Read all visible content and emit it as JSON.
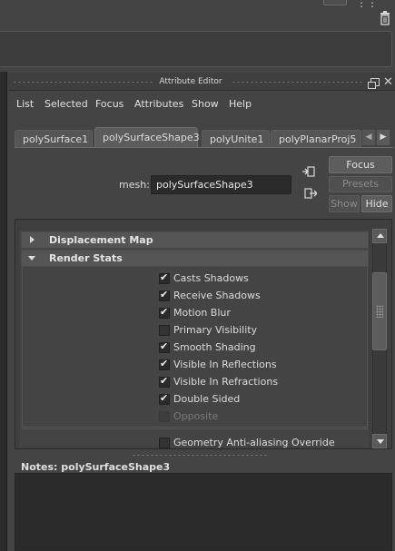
{
  "title": "Attribute Editor",
  "menu": [
    "List",
    "Selected",
    "Focus",
    "Attributes",
    "Show",
    "Help"
  ],
  "tabs": [
    {
      "label": "polySurface1",
      "active": false
    },
    {
      "label": "polySurfaceShape3",
      "active": true
    },
    {
      "label": "polyUnite1",
      "active": false
    },
    {
      "label": "polyPlanarProj5",
      "active": false
    }
  ],
  "mesh": {
    "label": "mesh:",
    "value": "polySurfaceShape3"
  },
  "buttons": {
    "focus": "Focus",
    "presets": "Presets",
    "show": "Show",
    "hide": "Hide"
  },
  "sections": {
    "displacement": {
      "label": "Displacement Map",
      "expanded": false
    },
    "render_stats": {
      "label": "Render Stats",
      "expanded": true
    }
  },
  "render_stats": [
    {
      "label": "Casts Shadows",
      "checked": true,
      "enabled": true
    },
    {
      "label": "Receive Shadows",
      "checked": true,
      "enabled": true
    },
    {
      "label": "Motion Blur",
      "checked": true,
      "enabled": true
    },
    {
      "label": "Primary Visibility",
      "checked": false,
      "enabled": true
    },
    {
      "label": "Smooth Shading",
      "checked": true,
      "enabled": true
    },
    {
      "label": "Visible In Reflections",
      "checked": true,
      "enabled": true
    },
    {
      "label": "Visible In Refractions",
      "checked": true,
      "enabled": true
    },
    {
      "label": "Double Sided",
      "checked": true,
      "enabled": true
    },
    {
      "label": "Opposite",
      "checked": false,
      "enabled": false
    },
    {
      "label": "Geometry Anti-aliasing Override",
      "checked": false,
      "enabled": true
    }
  ],
  "notes": {
    "label": "Notes:  polySurfaceShape3"
  },
  "colors": {
    "panel_bg": "#444444",
    "field_bg": "#2b2b2b",
    "section_bg": "#555555",
    "text": "#dcdcdc"
  }
}
